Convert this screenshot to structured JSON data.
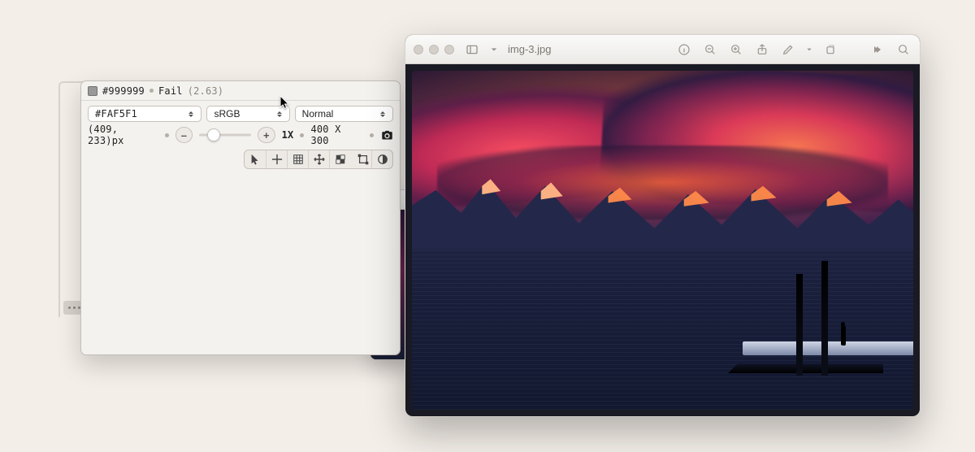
{
  "inspector": {
    "sample_swatch_color": "#999999",
    "sample_hex": "#999999",
    "contrast_status": "Fail",
    "contrast_ratio_text": "(2.63)",
    "bg_hex_value": "#FAF5F1",
    "color_space": "sRGB",
    "blend_mode": "Normal",
    "coords_text": "(409, 233)px",
    "zoom_label": "1X",
    "dimensions_text": "400 X 300",
    "tools": {
      "pointer": "pointer-tool",
      "crosshair": "crosshair-tool",
      "grid": "grid-tool",
      "move": "move-tool",
      "checker": "checker-tool",
      "crop": "crop-tool",
      "contrast": "contrast-circle-tool"
    }
  },
  "preview": {
    "filename": "img-3.jpg"
  }
}
